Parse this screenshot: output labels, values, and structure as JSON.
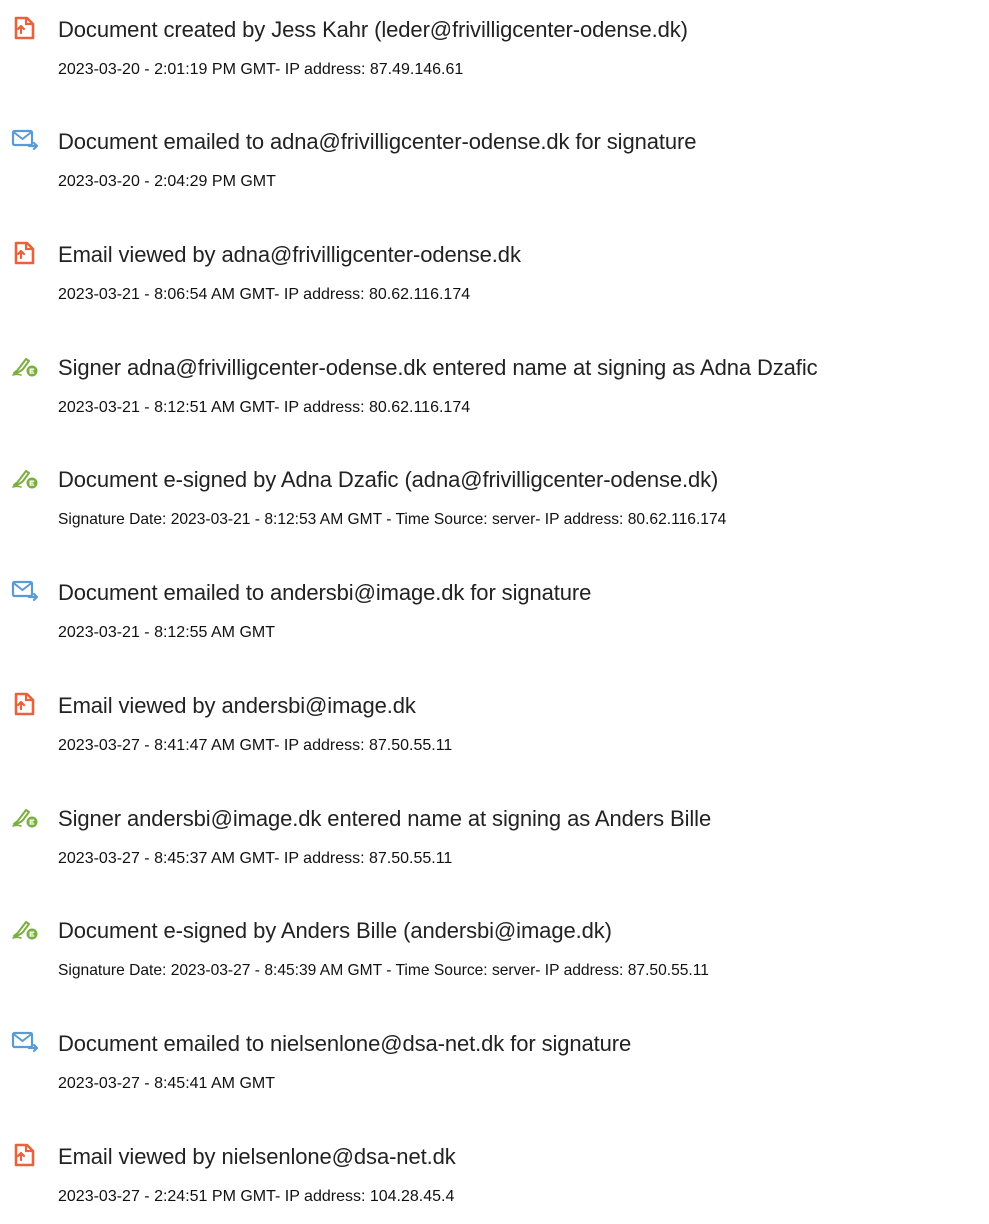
{
  "events": [
    {
      "icon": "document-created-icon",
      "title": "Document created by Jess Kahr (leder@frivilligcenter-odense.dk)",
      "detail": "2023-03-20 - 2:01:19 PM GMT- IP address: 87.49.146.61"
    },
    {
      "icon": "email-sent-icon",
      "title": "Document emailed to adna@frivilligcenter-odense.dk for signature",
      "detail": "2023-03-20 - 2:04:29 PM GMT"
    },
    {
      "icon": "email-viewed-icon",
      "title": "Email viewed by adna@frivilligcenter-odense.dk",
      "detail": "2023-03-21 - 8:06:54 AM GMT- IP address: 80.62.116.174"
    },
    {
      "icon": "signer-pen-icon",
      "title": "Signer adna@frivilligcenter-odense.dk entered name at signing as Adna Dzafic",
      "detail": "2023-03-21 - 8:12:51 AM GMT- IP address: 80.62.116.174"
    },
    {
      "icon": "e-signed-pen-icon",
      "title": "Document e-signed by Adna Dzafic (adna@frivilligcenter-odense.dk)",
      "detail": "Signature Date: 2023-03-21 - 8:12:53 AM GMT - Time Source: server- IP address: 80.62.116.174"
    },
    {
      "icon": "email-sent-icon",
      "title": "Document emailed to andersbi@image.dk for signature",
      "detail": "2023-03-21 - 8:12:55 AM GMT"
    },
    {
      "icon": "email-viewed-icon",
      "title": "Email viewed by andersbi@image.dk",
      "detail": "2023-03-27 - 8:41:47 AM GMT- IP address: 87.50.55.11"
    },
    {
      "icon": "signer-pen-icon",
      "title": "Signer andersbi@image.dk entered name at signing as Anders Bille",
      "detail": "2023-03-27 - 8:45:37 AM GMT- IP address: 87.50.55.11"
    },
    {
      "icon": "e-signed-pen-icon",
      "title": "Document e-signed by Anders Bille (andersbi@image.dk)",
      "detail": "Signature Date: 2023-03-27 - 8:45:39 AM GMT - Time Source: server- IP address: 87.50.55.11"
    },
    {
      "icon": "email-sent-icon",
      "title": "Document emailed to nielsenlone@dsa-net.dk for signature",
      "detail": "2023-03-27 - 8:45:41 AM GMT"
    },
    {
      "icon": "email-viewed-icon",
      "title": "Email viewed by nielsenlone@dsa-net.dk",
      "detail": "2023-03-27 - 2:24:51 PM GMT- IP address: 104.28.45.4"
    }
  ],
  "colors": {
    "document_icon": "#E8623D",
    "email_icon": "#5B9BD5",
    "pen_icon": "#7BAF3E",
    "title_text": "#222222",
    "detail_text": "#111111"
  }
}
